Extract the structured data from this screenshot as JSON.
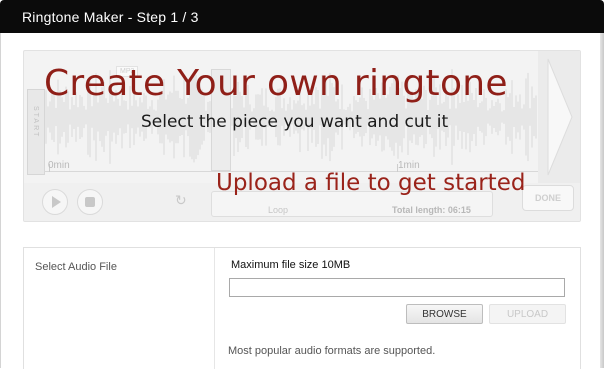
{
  "window": {
    "title": "Ringtone Maker - Step 1 / 3"
  },
  "editor": {
    "start_handle_label": "START",
    "tag_label": "MP3",
    "timeline_start": "0min",
    "timeline_mid": "1min",
    "loop_label": "Loop",
    "total_length_label": "Total length: 06:15",
    "done_label": "DONE",
    "play_icon": "play-icon",
    "stop_icon": "stop-icon",
    "refresh_icon": "refresh-icon"
  },
  "overlay": {
    "headline": "Create Your own ringtone",
    "subline": "Select the piece you want and cut it",
    "cta": "Upload a file to get started",
    "headline_color": "#8f1f18",
    "cta_color": "#9a231a"
  },
  "upload_panel": {
    "select_label": "Select Audio File",
    "max_size_text": "Maximum file size 10MB",
    "file_value": "",
    "browse_label": "BROWSE",
    "upload_label": "UPLOAD",
    "formats_text": "Most popular audio formats are supported."
  }
}
